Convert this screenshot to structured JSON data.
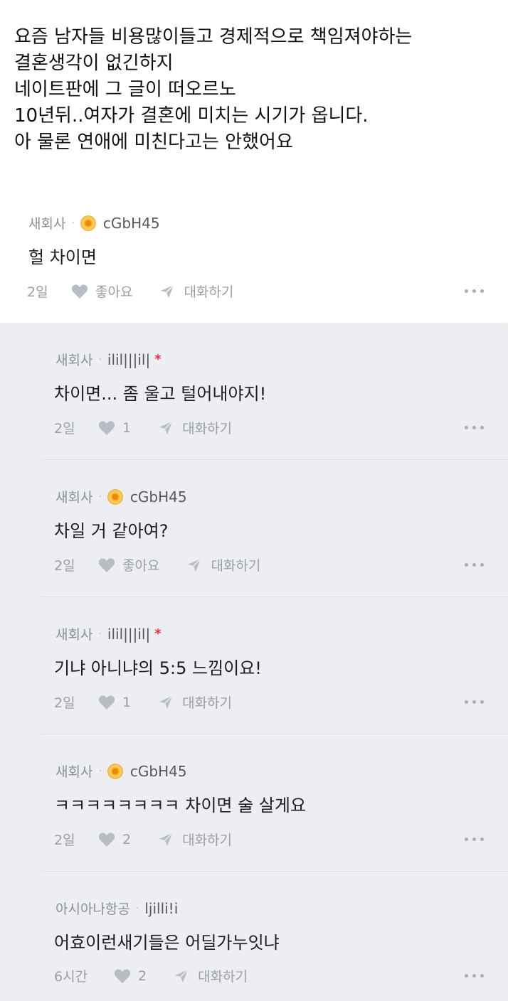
{
  "caption": {
    "lines": [
      "요즘 남자들 비용많이들고 경제적으로 책임져야하는",
      "결혼생각이 없긴하지",
      "네이트판에 그 글이 떠오르노",
      "10년뒤..여자가 결혼에 미치는 시기가 옵니다.",
      "아 물론 연애에 미친다고는 안했어요"
    ]
  },
  "top_comment": {
    "company": "새회사",
    "separator": "·",
    "user": "cGbH45",
    "text": "헐 차이면",
    "time": "2일",
    "like": "좋아요",
    "talk": "대화하기"
  },
  "replies": [
    {
      "company": "새회사",
      "separator": "·",
      "user": "ilil|||il|",
      "star": "*",
      "text": "차이면... 좀 울고 털어내야지!",
      "time": "2일",
      "like": "1",
      "talk": "대화하기"
    },
    {
      "company": "새회사",
      "separator": "·",
      "user": "cGbH45",
      "text": "차일 거 같아여?",
      "time": "2일",
      "like": "좋아요",
      "talk": "대화하기"
    },
    {
      "company": "새회사",
      "separator": "·",
      "user": "ilil|||il|",
      "star": "*",
      "text": "기냐 아니냐의 5:5 느낌이요!",
      "time": "2일",
      "like": "1",
      "talk": "대화하기"
    },
    {
      "company": "새회사",
      "separator": "·",
      "user": "cGbH45",
      "text": "ㅋㅋㅋㅋㅋㅋㅋㅋ 차이면 술 살게요",
      "time": "2일",
      "like": "2",
      "talk": "대화하기"
    },
    {
      "company": "아시아나항공",
      "separator": "·",
      "user": "ljilli!i",
      "text": "어효이런새기들은 어딜가누잇냐",
      "time": "6시간",
      "like": "2",
      "talk": "대화하기"
    }
  ]
}
